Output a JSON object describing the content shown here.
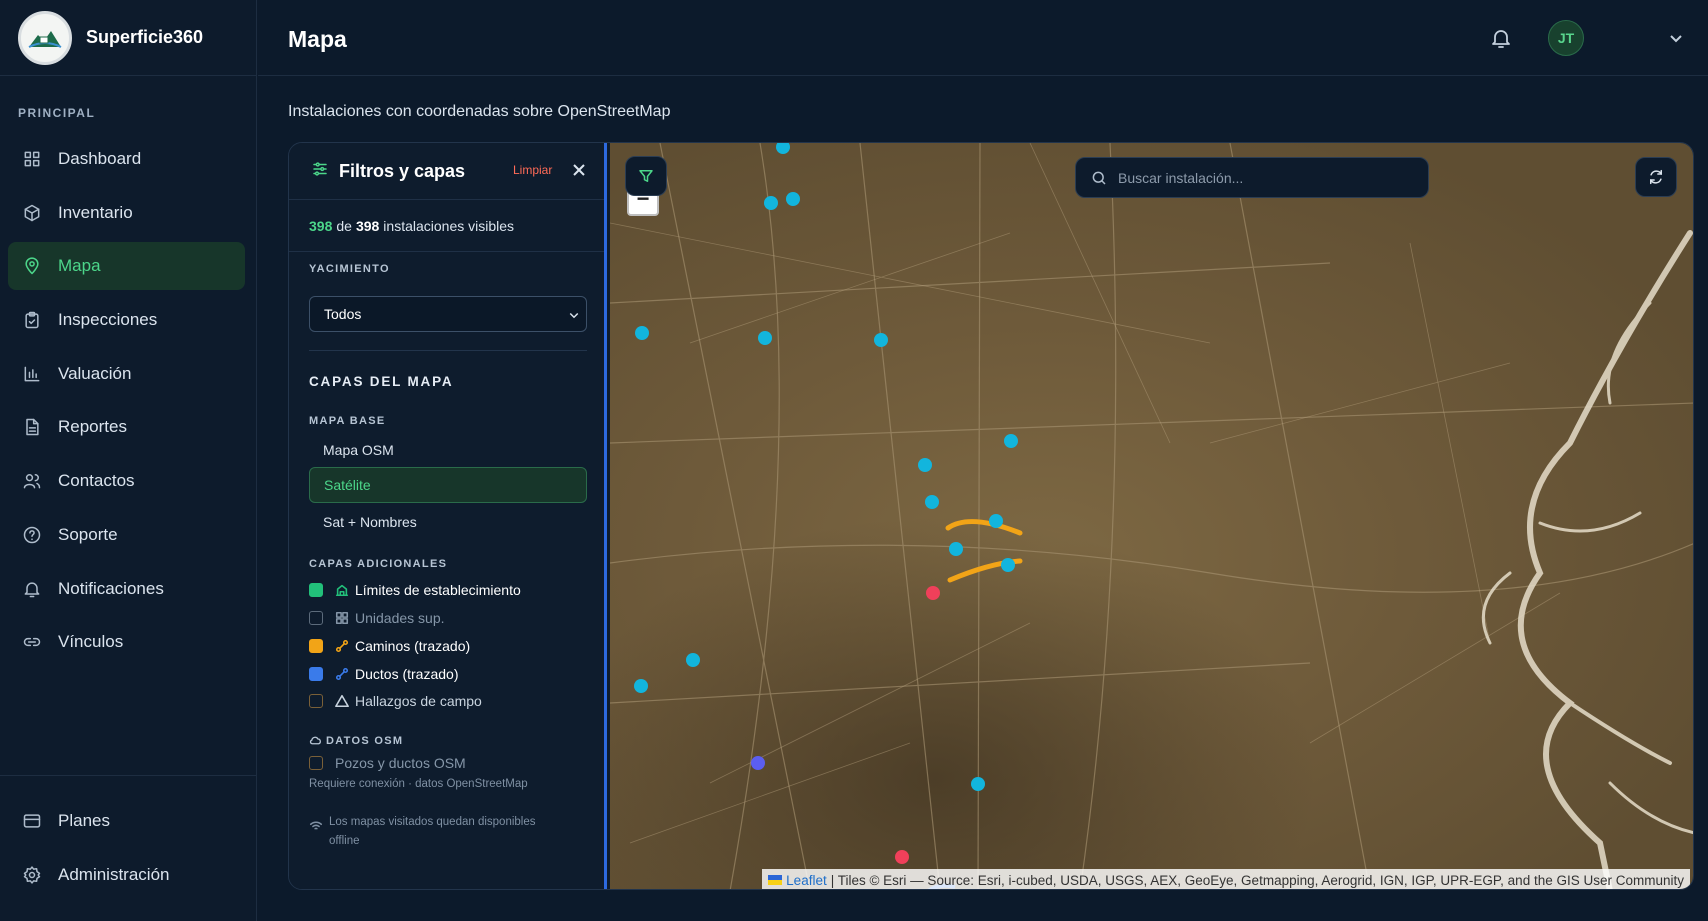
{
  "app": {
    "name": "Superficie360"
  },
  "sidebar": {
    "section_label": "PRINCIPAL",
    "items": [
      {
        "label": "Dashboard",
        "icon": "grid-icon"
      },
      {
        "label": "Inventario",
        "icon": "box-icon"
      },
      {
        "label": "Mapa",
        "icon": "map-pin-icon",
        "active": true
      },
      {
        "label": "Inspecciones",
        "icon": "clipboard-icon"
      },
      {
        "label": "Valuación",
        "icon": "bar-chart-icon"
      },
      {
        "label": "Reportes",
        "icon": "document-icon"
      },
      {
        "label": "Contactos",
        "icon": "users-icon"
      },
      {
        "label": "Soporte",
        "icon": "help-circle-icon"
      },
      {
        "label": "Notificaciones",
        "icon": "bell-icon"
      },
      {
        "label": "Vínculos",
        "icon": "link-icon"
      }
    ],
    "bottom_items": [
      {
        "label": "Planes",
        "icon": "credit-card-icon"
      },
      {
        "label": "Administración",
        "icon": "settings-icon"
      }
    ]
  },
  "header": {
    "title": "Mapa",
    "user_initials": "JT"
  },
  "page": {
    "subtitle": "Instalaciones con coordenadas sobre OpenStreetMap"
  },
  "filters": {
    "title": "Filtros y capas",
    "clear_label": "Limpiar",
    "visible_count": "398",
    "total_count": "398",
    "count_of": "de",
    "count_suffix": "instalaciones visibles",
    "field_label": "YACIMIENTO",
    "field_value": "Todos",
    "layers_title": "CAPAS DEL MAPA",
    "base_label": "MAPA BASE",
    "base_options": [
      "Mapa OSM",
      "Satélite",
      "Sat + Nombres"
    ],
    "base_selected": "Satélite",
    "extra_label": "CAPAS ADICIONALES",
    "layers": [
      {
        "label": "Límites de establecimiento",
        "checked": true,
        "color": "#22c07a"
      },
      {
        "label": "Unidades sup.",
        "checked": false
      },
      {
        "label": "Caminos (trazado)",
        "checked": true,
        "color": "#f2a417"
      },
      {
        "label": "Ductos (trazado)",
        "checked": true,
        "color": "#3a7bea"
      },
      {
        "label": "Hallazgos de campo",
        "checked": false
      }
    ],
    "osm_label": "DATOS OSM",
    "osm_layer": {
      "label": "Pozos y ductos OSM",
      "checked": false
    },
    "osm_hint": "Requiere conexión · datos OpenStreetMap",
    "offline_hint_1": "Los mapas visitados quedan disponibles",
    "offline_hint_2": "offline"
  },
  "map": {
    "search_placeholder": "Buscar instalación...",
    "zoom_out_label": "−",
    "attribution_link": "Leaflet",
    "attribution_text": "| Tiles © Esri — Source: Esri, i-cubed, USDA, USGS, AEX, GeoEye, Getmapping, Aerogrid, IGN, IGP, UPR-EGP, and the GIS User Community",
    "marker_colors": {
      "installation": "#12b5dd",
      "alert": "#f0405a",
      "other": "#5b5ef0",
      "road": "#f2a417",
      "duct": "#3a7bea"
    }
  }
}
